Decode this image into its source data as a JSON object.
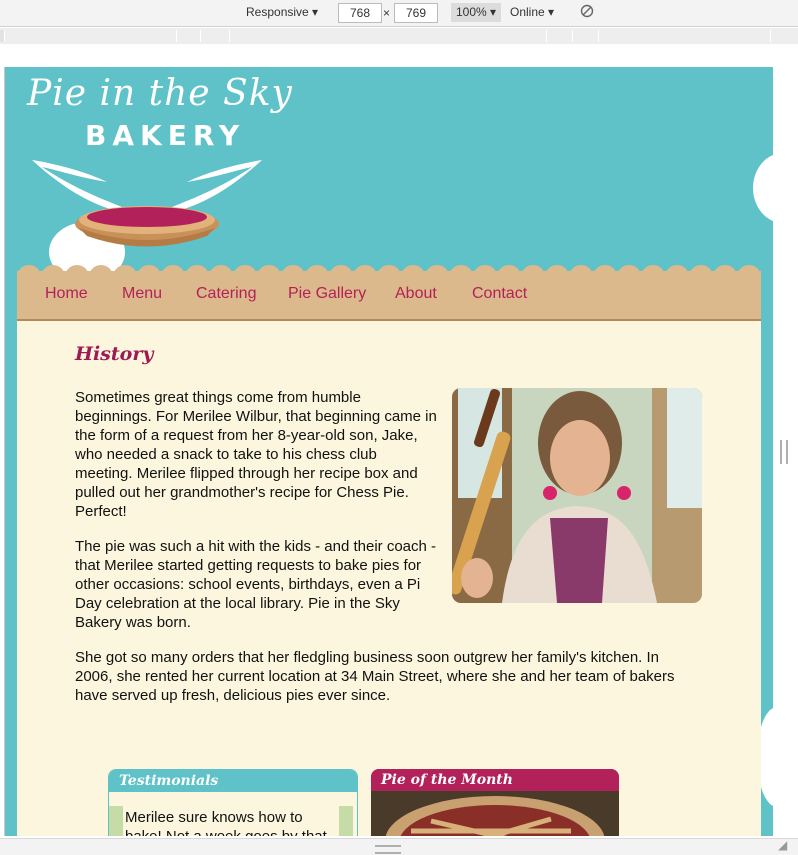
{
  "devtools": {
    "device_mode": "Responsive",
    "width": "768",
    "times": "×",
    "height": "769",
    "zoom": "100%",
    "network": "Online"
  },
  "site": {
    "logo_script": "Pie in the Sky",
    "logo_bakery": "BAKERY",
    "nav": [
      "Home",
      "Menu",
      "Catering",
      "Pie Gallery",
      "About",
      "Contact"
    ],
    "heading": "History",
    "paragraphs": [
      "Sometimes great things come from humble beginnings. For Merilee Wilbur, that beginning came in the form of a request from her 8-year-old son, Jake, who needed a snack to take to his chess club meeting. Merilee flipped through her recipe box and pulled out her grandmother's recipe for Chess Pie. Perfect!",
      "The pie was such a hit with the kids - and their coach - that Merilee started getting requests to bake pies for other occasions: school events, birthdays, even a Pi Day celebration at the local library. Pie in the Sky Bakery was born.",
      "She got so many orders that her fledgling business soon outgrew her family's kitchen. In 2006, she rented her current location at 34 Main Street, where she and her team of bakers have served up fresh, delicious pies ever since."
    ],
    "testimonials": {
      "title": "Testimonials",
      "text": "Merilee sure knows how to bake! Not a week goes by that I"
    },
    "pie_of_month": {
      "title": "Pie of the Month"
    }
  },
  "colors": {
    "background": "#5fc2c8",
    "nav": "#dcb98c",
    "accent": "#b22159",
    "content": "#fcf6de"
  }
}
